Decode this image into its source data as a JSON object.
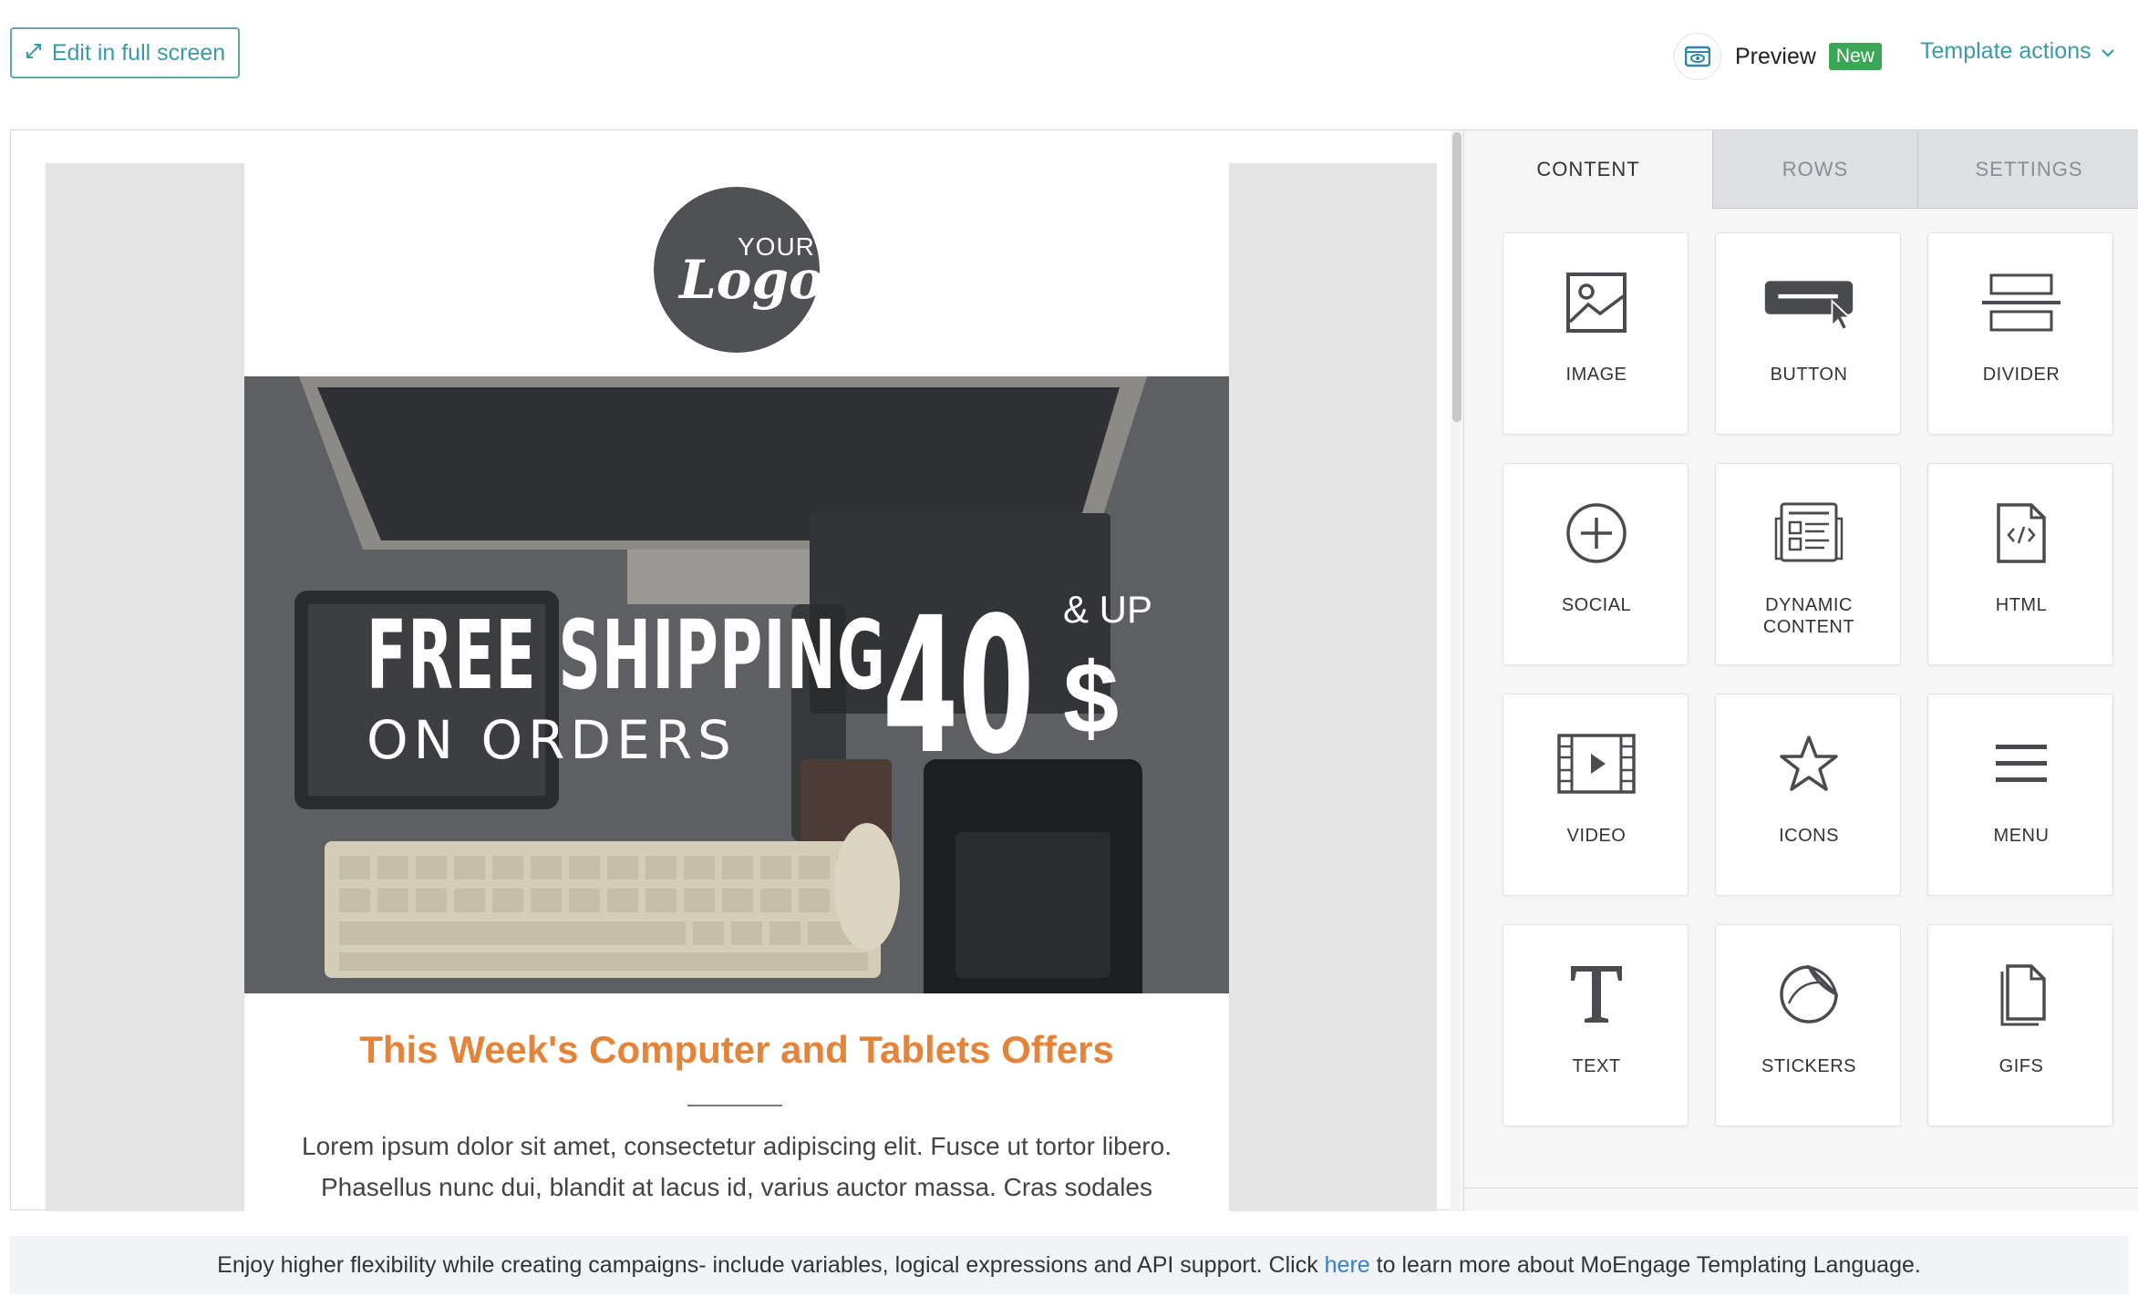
{
  "toolbar": {
    "fullscreen_label": "Edit in full screen",
    "preview_label": "Preview",
    "new_badge": "New",
    "template_actions_label": "Template actions"
  },
  "email": {
    "logo_top": "YOUR",
    "logo_main": "Logo",
    "hero": {
      "line1": "FREE SHIPPING",
      "line2": "ON ORDERS",
      "price": "40",
      "and_up": "& UP",
      "currency": "$"
    },
    "title": "This Week's Computer and Tablets Offers",
    "body": "Lorem ipsum dolor sit amet, consectetur adipiscing elit. Fusce ut tortor libero. Phasellus nunc dui, blandit at lacus id, varius auctor massa. Cras sodales"
  },
  "panel": {
    "tabs": [
      {
        "label": "CONTENT",
        "active": true
      },
      {
        "label": "ROWS",
        "active": false
      },
      {
        "label": "SETTINGS",
        "active": false
      }
    ],
    "tiles": [
      {
        "label": "IMAGE",
        "icon": "image-icon"
      },
      {
        "label": "BUTTON",
        "icon": "button-icon"
      },
      {
        "label": "DIVIDER",
        "icon": "divider-icon"
      },
      {
        "label": "SOCIAL",
        "icon": "social-icon"
      },
      {
        "label": "DYNAMIC CONTENT",
        "icon": "dynamic-content-icon"
      },
      {
        "label": "HTML",
        "icon": "html-icon"
      },
      {
        "label": "VIDEO",
        "icon": "video-icon"
      },
      {
        "label": "ICONS",
        "icon": "star-icon"
      },
      {
        "label": "MENU",
        "icon": "menu-icon"
      },
      {
        "label": "TEXT",
        "icon": "text-icon"
      },
      {
        "label": "STICKERS",
        "icon": "sticker-icon"
      },
      {
        "label": "GIFS",
        "icon": "gif-icon"
      }
    ]
  },
  "footer": {
    "before": "Enjoy higher flexibility while creating campaigns- include variables, logical expressions and API support. Click ",
    "link": "here",
    "after": " to learn more about MoEngage Templating Language."
  },
  "colors": {
    "accent": "#3a9aa6",
    "badge_green": "#3aa757",
    "offer_orange": "#e4843a",
    "link_blue": "#3a7dc6"
  }
}
